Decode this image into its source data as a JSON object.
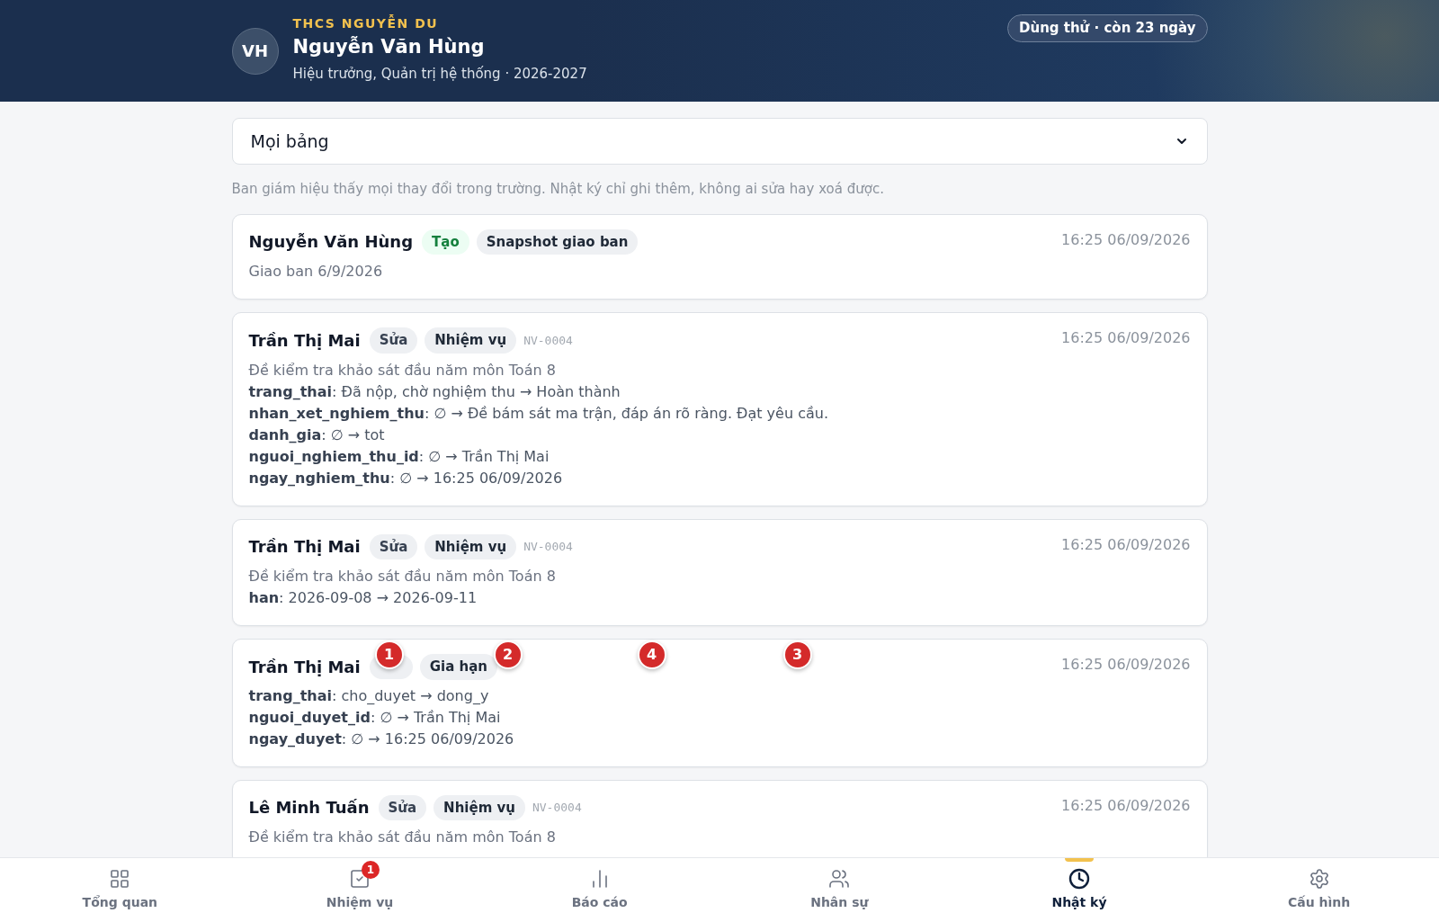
{
  "header": {
    "school": "THCS NGUYỄN DU",
    "avatar": "VH",
    "name": "Nguyễn Văn Hùng",
    "role": "Hiệu trưởng, Quản trị hệ thống · 2026-2027",
    "trial": "Dùng thử · còn 23 ngày"
  },
  "filter": {
    "value": "Mọi bảng"
  },
  "note": "Ban giám hiệu thấy mọi thay đổi trong trường. Nhật ký chỉ ghi thêm, không ai sửa hay xoá được.",
  "entries": [
    {
      "user": "Nguyễn Văn Hùng",
      "action": {
        "label": "Tạo",
        "kind": "create"
      },
      "entity": "Snapshot giao ban",
      "time": "16:25 06/09/2026",
      "lines": [
        {
          "kind": "text",
          "text": "Giao ban 6/9/2026"
        }
      ]
    },
    {
      "user": "Trần Thị Mai",
      "action": {
        "label": "Sửa",
        "kind": "edit"
      },
      "entity": "Nhiệm vụ",
      "code": "NV-0004",
      "time": "16:25 06/09/2026",
      "lines": [
        {
          "kind": "text",
          "text": "Đề kiểm tra khảo sát đầu năm môn Toán 8"
        },
        {
          "kind": "change",
          "text": "**trang_thai**: Đã nộp, chờ nghiệm thu → Hoàn thành"
        },
        {
          "kind": "change",
          "text": "**nhan_xet_nghiem_thu**: ∅ → Đề bám sát ma trận, đáp án rõ ràng. Đạt yêu cầu."
        },
        {
          "kind": "change",
          "text": "**danh_gia**: ∅ → tot"
        },
        {
          "kind": "change",
          "text": "**nguoi_nghiem_thu_id**: ∅ → Trần Thị Mai"
        },
        {
          "kind": "change",
          "text": "**ngay_nghiem_thu**: ∅ → 16:25 06/09/2026"
        }
      ]
    },
    {
      "user": "Trần Thị Mai",
      "action": {
        "label": "Sửa",
        "kind": "edit"
      },
      "entity": "Nhiệm vụ",
      "code": "NV-0004",
      "time": "16:25 06/09/2026",
      "lines": [
        {
          "kind": "text",
          "text": "Đề kiểm tra khảo sát đầu năm môn Toán 8"
        },
        {
          "kind": "change",
          "text": "**han**: 2026-09-08 → 2026-09-11"
        }
      ]
    },
    {
      "user": "Trần Thị Mai",
      "action": {
        "kind": "edit"
      },
      "entity": "Gia hạn",
      "time": "16:25 06/09/2026",
      "markers": [
        "1",
        "2",
        "4",
        "3"
      ],
      "lines": [
        {
          "kind": "change",
          "text": "**trang_thai**: cho_duyet → dong_y"
        },
        {
          "kind": "change",
          "text": "**nguoi_duyet_id**: ∅ → Trần Thị Mai"
        },
        {
          "kind": "change",
          "text": "**ngay_duyet**: ∅ → 16:25 06/09/2026"
        }
      ]
    },
    {
      "user": "Lê Minh Tuấn",
      "action": {
        "label": "Sửa",
        "kind": "edit"
      },
      "entity": "Nhiệm vụ",
      "code": "NV-0004",
      "time": "16:25 06/09/2026",
      "lines": [
        {
          "kind": "text",
          "text": "Đề kiểm tra khảo sát đầu năm môn Toán 8"
        }
      ]
    }
  ],
  "nav": [
    {
      "label": "Tổng quan",
      "selected": false
    },
    {
      "label": "Nhiệm vụ",
      "selected": false,
      "badge": "1"
    },
    {
      "label": "Báo cáo",
      "selected": false
    },
    {
      "label": "Nhân sự",
      "selected": false
    },
    {
      "label": "Nhật ký",
      "selected": true
    },
    {
      "label": "Cấu hình",
      "selected": false
    }
  ]
}
